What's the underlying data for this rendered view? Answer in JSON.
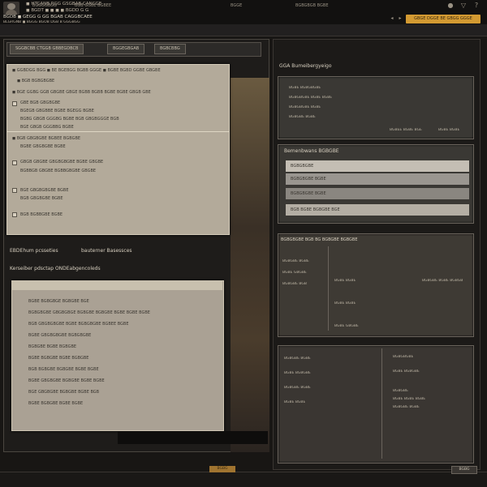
{
  "topbar": {
    "line1": "◼ HTCANB RGG  GSGBAB CANCGE",
    "line2": "◼ BGDT ◼ ◼ ◼ ◼ BGDD    G G",
    "line3": "BGDB ◼ GEGG G GG BGAB CAGGBCAEE",
    "line4": "BLGRGNB ◼ BGGG BGOB DGB B GGGBGG",
    "accent_label": "GBGE DGGE BE GBGG GGGE",
    "icons": [
      "bell-icon",
      "filter-icon",
      "help-icon"
    ]
  },
  "subbar": {
    "tabs": [
      "BGGGGBGG",
      "BGB GGBE BGBEE",
      "BGGE",
      "BGBGBGB BGBE"
    ]
  },
  "left": {
    "tabs": [
      "SGGBCBB CTGGB GBBEGDBCB",
      "BGGEGBGAB",
      "BGBCBBG"
    ],
    "dialog1": {
      "rows": [
        "◼ GGBDGG BGG ◼ BE BGEBGG BGBB GGGE ◼ BGBE BGBD GGBE GBGBE",
        "◼ BGB BGBGBGBE",
        "◼ BGE GGBG GGB GBGBE GBGE BGBB BGBB BGBE BGBE GBGB GBE",
        "GBE BGB GBGBGBE",
        "BGEGB GBGBBE BGBE BGEGG BGBE",
        "BGBG GBGB GGGBG BGBE BGB GBGBGGGE BGB",
        "BGE GBGB GGGBBG BGBE",
        "◼ BGB GBGBGBE BGBEE BGBGBE",
        "BGBE GBGBGBE BGBE",
        "GBGB GBGBE GBGBGBGBE BGBE GBGBE",
        "BGBBGB GBGBE BGBBGBGBE GBGBE",
        "BGE GBGBGBGBE BGBE",
        "BGB GBGBGBE BGBE",
        "BGB BGBBGBE BGBE"
      ]
    },
    "label1a": "EBDEhum pcsseties",
    "label1b": "bauterner Basessces",
    "label2": "Kerseiber pdsctap ONDEabgencoleds",
    "dialog2": {
      "rows": [
        "BGBE BGBGBGE BGBGBE BGE",
        "BGBGBGBE GBGBGBGE BGBGBE BGBGBE BGBE BGBE BGBE",
        "BGB GBGBGBGBE BGBE BGBGBGBE BGBEE BGBE",
        "BGBE GBGBGBGBE BGBGBGBE",
        "BGBGBE BGBE BGBGBE",
        "BGBE BGBGBE BGBE BGBGBE",
        "BGB BGBGBE BGBGBE BGBE BGBE",
        "BGBE GBGBGBE BGBGBE BGBE BGBE",
        "BGE GBGBGBE BGBGBE BGBE BGB",
        "BGBE BGBGBE BGBE BGBE"
      ]
    }
  },
  "right": {
    "section1_title": "GGA Bumeibergyeigo",
    "box1_rows": [
      "BGBE BGBGBGBE",
      "BGBGBGBE BGBE BGBE",
      "BGBGBGBE BGBE",
      "BGBGBE BGBE"
    ],
    "box1_footer": [
      "BGBEE BGBE BGE",
      "BGBE BGBE"
    ],
    "section2_title": "Bemenbwans BGBGBE",
    "list_items": [
      "BGBGBGBE",
      "BGBGBGBE BGBE",
      "BGBGBGBE BGBE",
      "BGB BGBE BGBGBE BGE"
    ],
    "section3_title": "BGBGBGBE BGB BG BGBGBE BGBGBE",
    "box3_left": [
      "BGBGBE BGBE",
      "BGBE GBGBE",
      "BGBGBE BGB"
    ],
    "box3_right": [
      "BGBE BGBE",
      "BGBGBE BGBE BGBGB",
      "BGBE BGBE",
      "BGBE GBGBE"
    ],
    "box4_left": [
      "BGBGBE BGBE",
      "BGBE BGBGBE",
      "BGBGBE BGBE",
      "BGBE BGBE"
    ],
    "box4_right": [
      "BGBGBGBE",
      "BGBE BGBGBE",
      "BGBGBE",
      "BGBE BGBE BGBE",
      "BGBGBE BGBE"
    ]
  },
  "bottombar": {
    "button1": "BGBG",
    "button2": "BGBG"
  },
  "colors": {
    "accent": "#d39a32",
    "dialog_bg": "#b3aa9a",
    "panel_bg": "#1e1c1a"
  }
}
